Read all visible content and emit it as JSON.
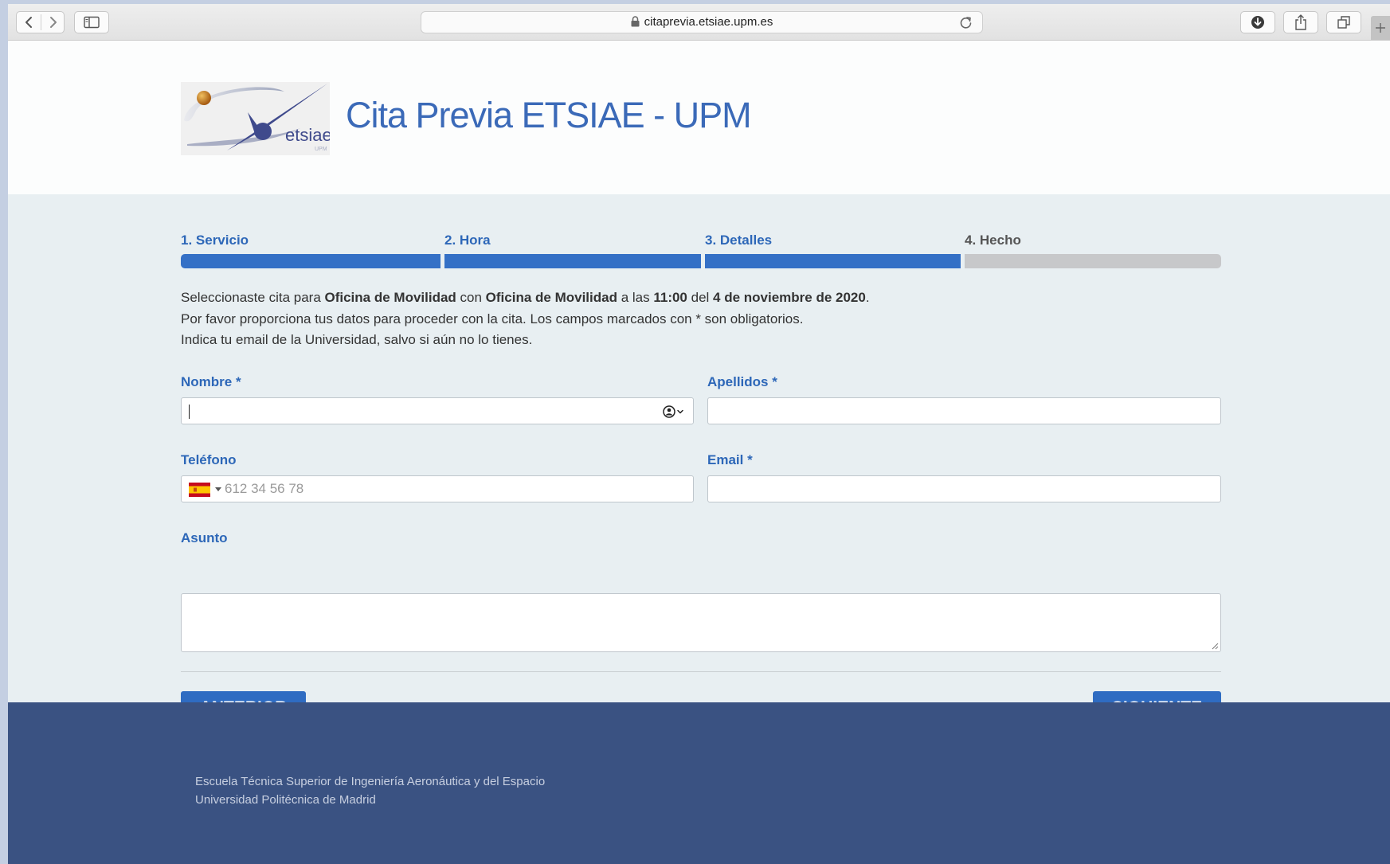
{
  "browser": {
    "url": "citaprevia.etsiae.upm.es",
    "icons": [
      "back-icon",
      "forward-icon",
      "sidebar-icon",
      "lock-icon",
      "reload-icon",
      "download-icon",
      "share-icon",
      "tabs-icon",
      "new-tab-icon"
    ]
  },
  "header": {
    "logo_text": "etsiae",
    "logo_subtext": "UPM",
    "title": "Cita Previa ETSIAE - UPM"
  },
  "steps": [
    {
      "label": "1. Servicio",
      "state": "complete"
    },
    {
      "label": "2. Hora",
      "state": "complete"
    },
    {
      "label": "3. Detalles",
      "state": "current"
    },
    {
      "label": "4. Hecho",
      "state": "pending"
    }
  ],
  "info": {
    "line1": {
      "p1": "Seleccionaste cita para ",
      "service": "Oficina de Movilidad",
      "p2": " con ",
      "staff": "Oficina de Movilidad",
      "p3": " a las ",
      "time": "11:00",
      "p4": " del ",
      "date": "4 de noviembre de 2020",
      "p5": "."
    },
    "line2": "Por favor proporciona tus datos para proceder con la cita. Los campos marcados con * son obligatorios.",
    "line3": "Indica tu email de la Universidad, salvo si aún no lo tienes."
  },
  "form": {
    "nombre": {
      "label": "Nombre *",
      "value": ""
    },
    "apellidos": {
      "label": "Apellidos *",
      "value": ""
    },
    "telefono": {
      "label": "Teléfono",
      "placeholder": "612 34 56 78",
      "country": "ES"
    },
    "email": {
      "label": "Email *",
      "value": ""
    },
    "asunto": {
      "label": "Asunto",
      "value": ""
    }
  },
  "buttons": {
    "prev": "ANTERIOR",
    "next": "SIGUIENTE"
  },
  "footer": {
    "line1": "Escuela Técnica Superior de Ingeniería Aeronáutica y del Espacio",
    "line2": "Universidad Politécnica de Madrid"
  },
  "colors": {
    "accent": "#3470c6",
    "pending_bar": "#c7c8ca",
    "footer_bg": "#3a5282"
  }
}
